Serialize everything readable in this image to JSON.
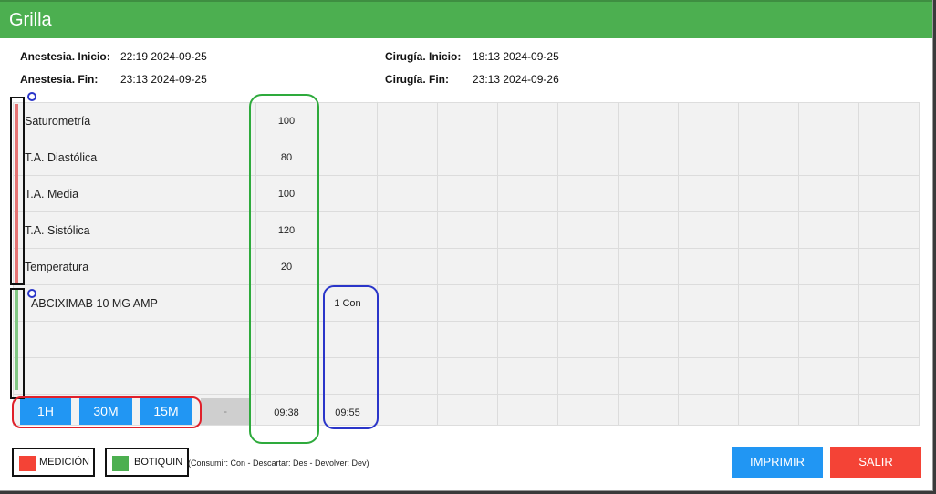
{
  "window": {
    "title": "Grilla"
  },
  "info": {
    "anestesia_inicio_label": "Anestesia. Inicio:",
    "anestesia_inicio_value": "22:19 2024-09-25",
    "anestesia_fin_label": "Anestesia. Fin:",
    "anestesia_fin_value": "23:13 2024-09-25",
    "cirugia_inicio_label": "Cirugía. Inicio:",
    "cirugia_inicio_value": "18:13 2024-09-25",
    "cirugia_fin_label": "Cirugía. Fin:",
    "cirugia_fin_value": "23:13 2024-09-26"
  },
  "grid": {
    "rows": [
      {
        "label": "Saturometría",
        "col1": "100",
        "col2": ""
      },
      {
        "label": "T.A. Diastólica",
        "col1": "80",
        "col2": ""
      },
      {
        "label": "T.A. Media",
        "col1": "100",
        "col2": ""
      },
      {
        "label": "T.A. Sistólica",
        "col1": "120",
        "col2": ""
      },
      {
        "label": "Temperatura",
        "col1": "20",
        "col2": ""
      },
      {
        "label": "- ABCIXIMAB 10 MG AMP",
        "col1": "",
        "col2": "1 Con"
      },
      {
        "label": "",
        "col1": "",
        "col2": ""
      },
      {
        "label": "",
        "col1": "",
        "col2": ""
      }
    ],
    "times": {
      "col1": "09:38",
      "col2": "09:55"
    },
    "dash": "-"
  },
  "interval_buttons": {
    "h1": "1H",
    "m30": "30M",
    "m15": "15M"
  },
  "legend": {
    "medicion": "MEDICIÓN",
    "botiquin": "BOTIQUIN",
    "note": "(Consumir: Con - Descartar: Des - Devolver: Dev)"
  },
  "actions": {
    "print": "IMPRIMIR",
    "exit": "SALIR"
  },
  "colors": {
    "title_bar": "#4caf50",
    "medicion": "#f44336",
    "botiquin": "#4caf50",
    "primary_button": "#2196f3",
    "exit_button": "#f44336"
  }
}
